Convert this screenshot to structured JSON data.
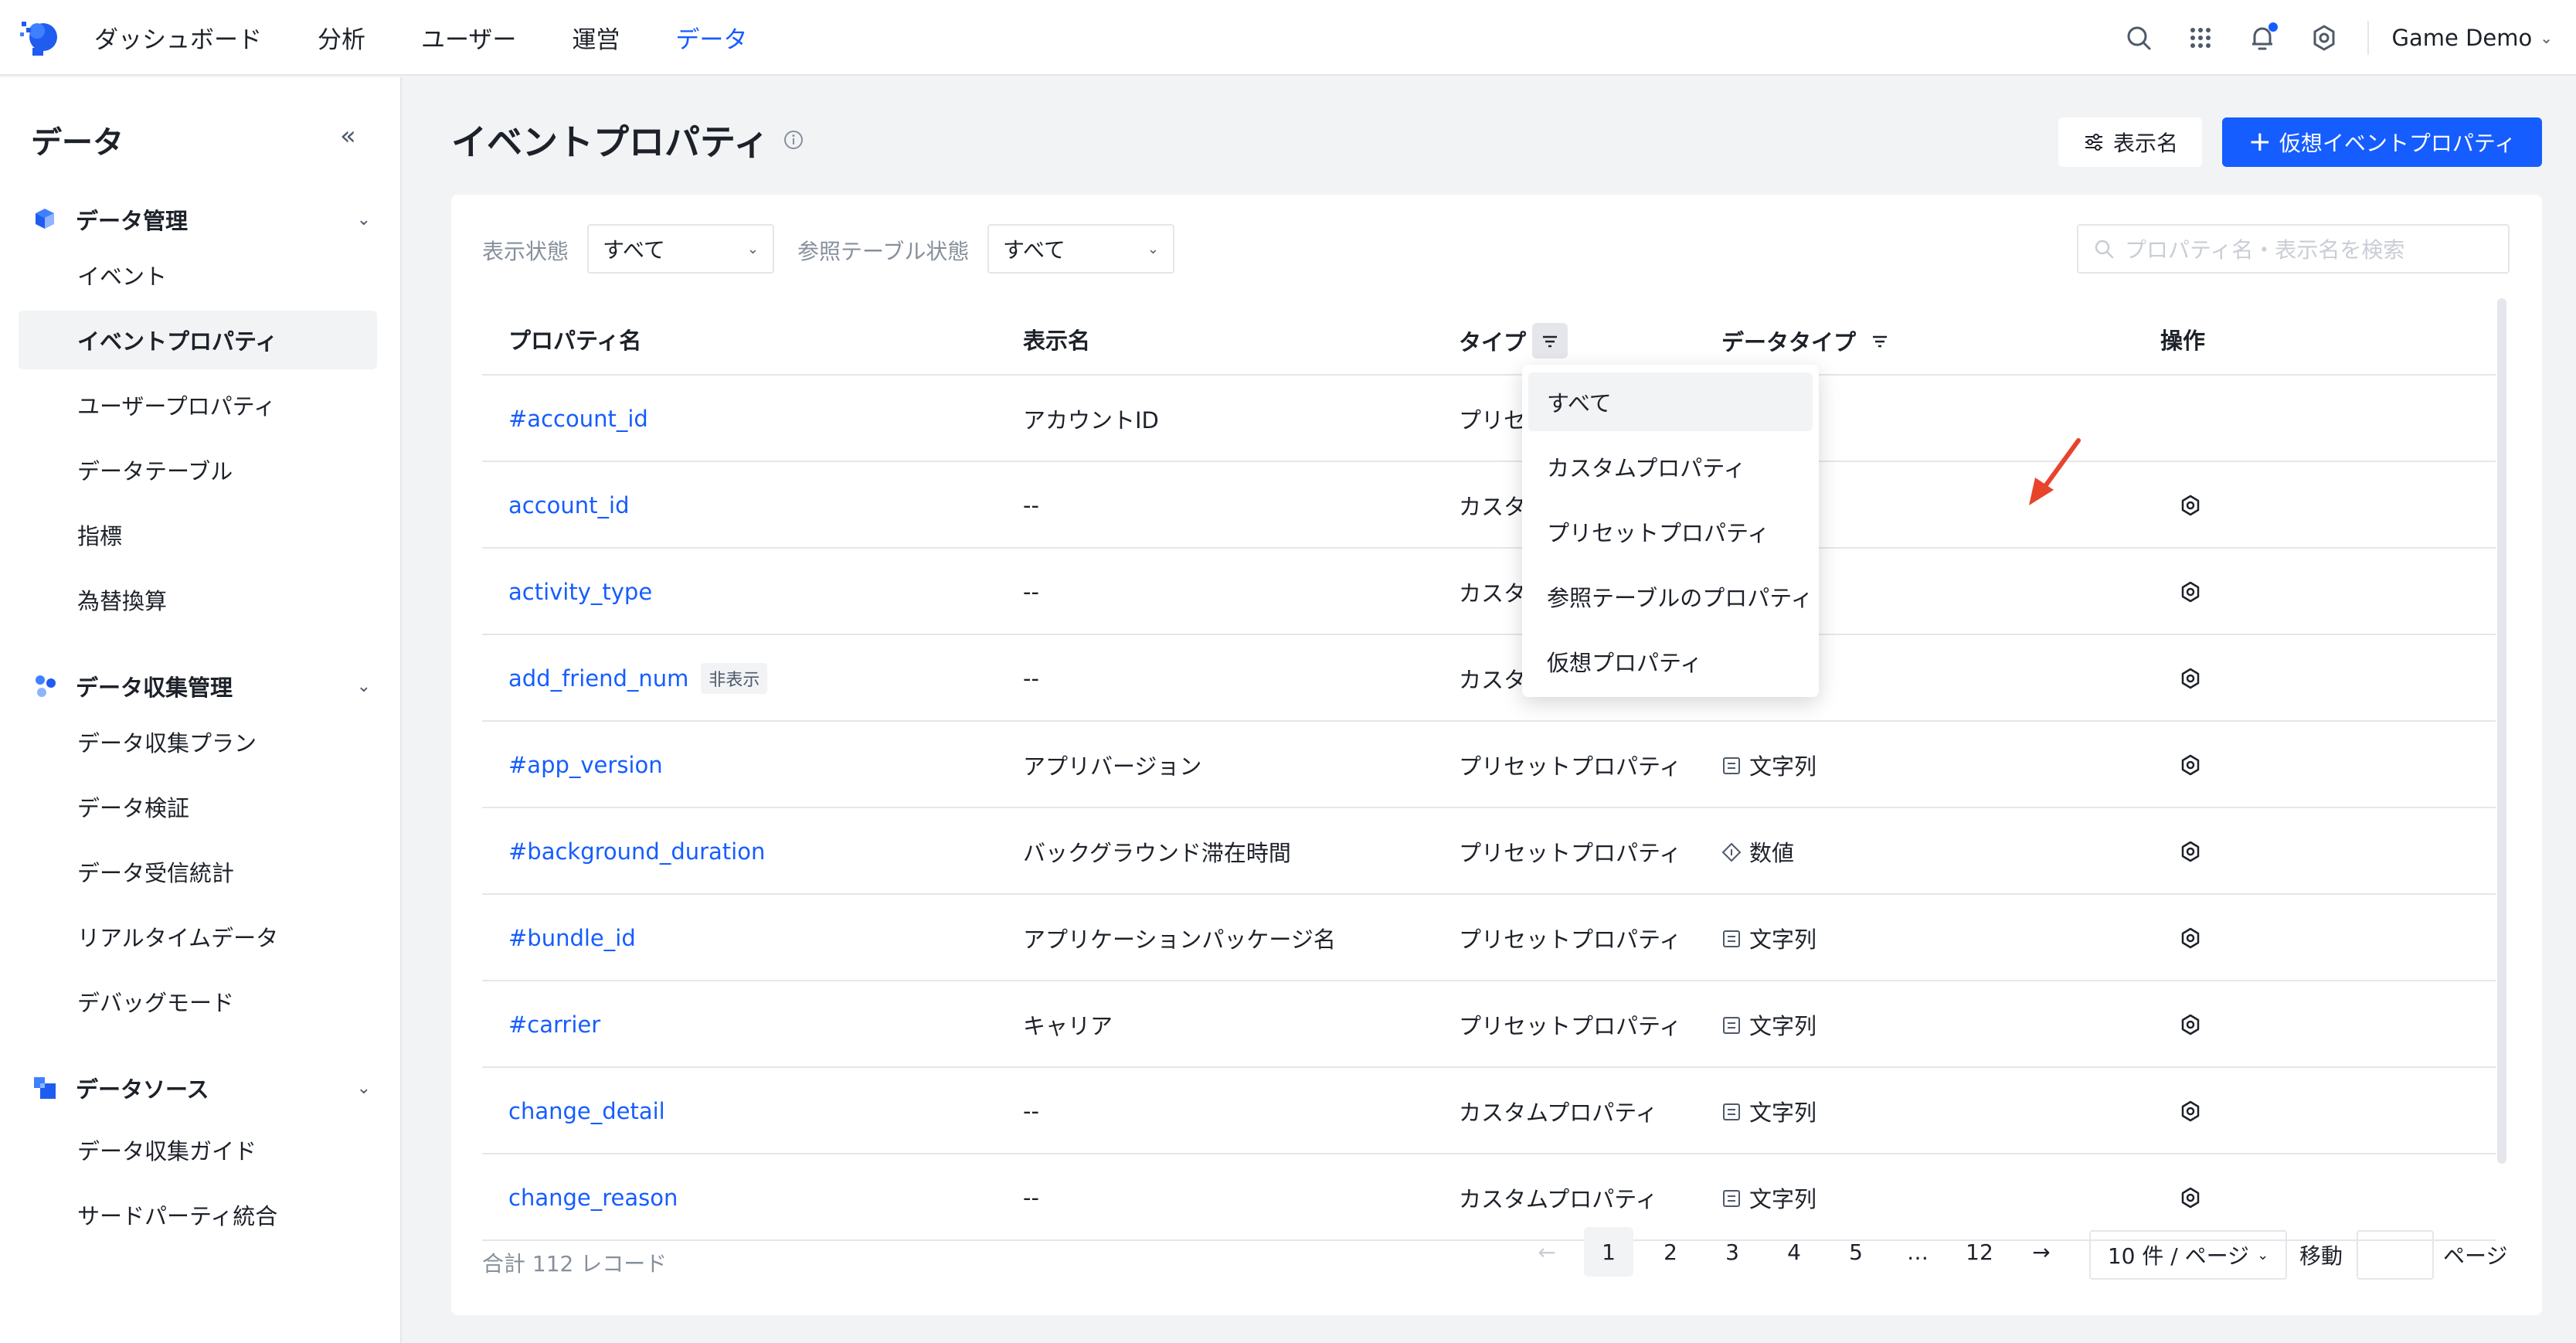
{
  "topnav": {
    "items": [
      "ダッシュボード",
      "分析",
      "ユーザー",
      "運営",
      "データ"
    ],
    "active_index": 4,
    "user_name": "Game Demo"
  },
  "sidebar": {
    "title": "データ",
    "collapse_glyph": "«",
    "groups": [
      {
        "label": "データ管理",
        "items": [
          "イベント",
          "イベントプロパティ",
          "ユーザープロパティ",
          "データテーブル",
          "指標",
          "為替換算"
        ]
      },
      {
        "label": "データ収集管理",
        "items": [
          "データ収集プラン",
          "データ検証",
          "データ受信統計",
          "リアルタイムデータ",
          "デバッグモード"
        ]
      },
      {
        "label": "データソース",
        "items": [
          "データ収集ガイド",
          "サードパーティ統合"
        ]
      }
    ],
    "active_item": "イベントプロパティ"
  },
  "page": {
    "title": "イベントプロパティ",
    "display_button": "表示名",
    "primary_button": "仮想イベントプロパティ"
  },
  "filters": {
    "display_state_label": "表示状態",
    "display_state_value": "すべて",
    "ref_table_label": "参照テーブル状態",
    "ref_table_value": "すべて",
    "search_placeholder": "プロパティ名・表示名を検索"
  },
  "table": {
    "columns": [
      "プロパティ名",
      "表示名",
      "タイプ",
      "データタイプ",
      "操作"
    ],
    "rows": [
      {
        "name": "#account_id",
        "display": "アカウントID",
        "type": "プリセ",
        "dtype": "",
        "dtype_icon": "",
        "tag": "",
        "action": false
      },
      {
        "name": "account_id",
        "display": "--",
        "type": "カスタ",
        "dtype": "",
        "dtype_icon": "",
        "tag": "",
        "action": true
      },
      {
        "name": "activity_type",
        "display": "--",
        "type": "カスタ",
        "dtype": "",
        "dtype_icon": "",
        "tag": "",
        "action": true
      },
      {
        "name": "add_friend_num",
        "display": "--",
        "type": "カスタ",
        "dtype": "",
        "dtype_icon": "",
        "tag": "非表示",
        "action": true
      },
      {
        "name": "#app_version",
        "display": "アプリバージョン",
        "type": "プリセットプロパティ",
        "dtype": "文字列",
        "dtype_icon": "string-type-icon",
        "tag": "",
        "action": true
      },
      {
        "name": "#background_duration",
        "display": "バックグラウンド滞在時間",
        "type": "プリセットプロパティ",
        "dtype": "数値",
        "dtype_icon": "number-type-icon",
        "tag": "",
        "action": true
      },
      {
        "name": "#bundle_id",
        "display": "アプリケーションパッケージ名",
        "type": "プリセットプロパティ",
        "dtype": "文字列",
        "dtype_icon": "string-type-icon",
        "tag": "",
        "action": true
      },
      {
        "name": "#carrier",
        "display": "キャリア",
        "type": "プリセットプロパティ",
        "dtype": "文字列",
        "dtype_icon": "string-type-icon",
        "tag": "",
        "action": true
      },
      {
        "name": "change_detail",
        "display": "--",
        "type": "カスタムプロパティ",
        "dtype": "文字列",
        "dtype_icon": "string-type-icon",
        "tag": "",
        "action": true
      },
      {
        "name": "change_reason",
        "display": "--",
        "type": "カスタムプロパティ",
        "dtype": "文字列",
        "dtype_icon": "string-type-icon",
        "tag": "",
        "action": true
      }
    ]
  },
  "type_dropdown": {
    "options": [
      "すべて",
      "カスタムプロパティ",
      "プリセットプロパティ",
      "参照テーブルのプロパティ",
      "仮想プロパティ"
    ],
    "selected": "すべて"
  },
  "footer": {
    "total": "合計 112 レコード",
    "pages": [
      "1",
      "2",
      "3",
      "4",
      "5",
      "…",
      "12"
    ],
    "current_page": "1",
    "prev_glyph": "←",
    "next_glyph": "→",
    "page_size": "10 件 / ページ",
    "goto_label": "移動",
    "page_label": "ページ"
  },
  "colors": {
    "accent": "#165dff",
    "arrow": "#e8442c"
  }
}
